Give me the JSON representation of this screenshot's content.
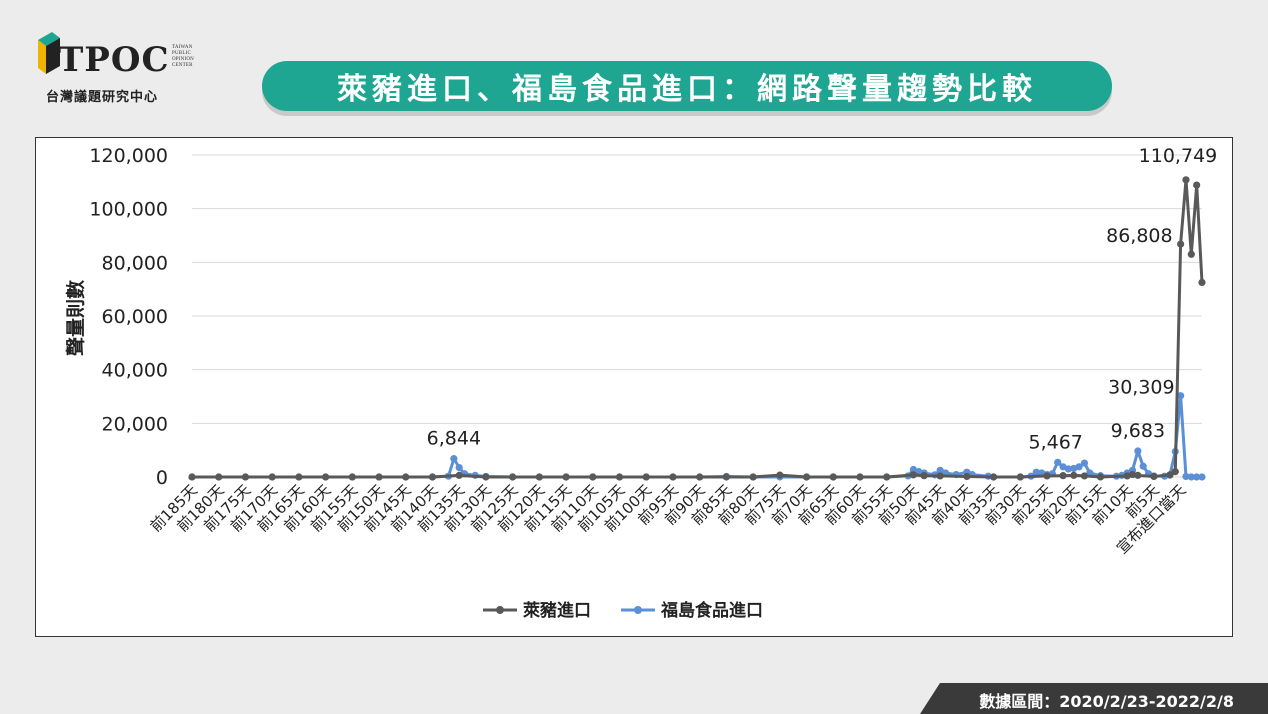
{
  "logo": {
    "name": "TPOC",
    "side_text": [
      "TAIWAN",
      "PUBLIC",
      "OPINION",
      "CENTER"
    ],
    "subtitle": "台灣議題研究中心"
  },
  "title": "萊豬進口、福島食品進口：網路聲量趨勢比較",
  "footer": "數據區間：2020/2/23-2022/2/8",
  "chart_data": {
    "type": "line",
    "ylabel": "聲量則數",
    "ylim": [
      0,
      120000
    ],
    "y_ticks": [
      "120,000",
      "100,000",
      "80,000",
      "60,000",
      "40,000",
      "20,000",
      "0"
    ],
    "x_tick_labels": [
      "前185天",
      "前180天",
      "前175天",
      "前170天",
      "前165天",
      "前160天",
      "前155天",
      "前150天",
      "前145天",
      "前140天",
      "前135天",
      "前130天",
      "前125天",
      "前120天",
      "前115天",
      "前110天",
      "前105天",
      "前100天",
      "前95天",
      "前90天",
      "前85天",
      "前80天",
      "前75天",
      "前70天",
      "前65天",
      "前60天",
      "前55天",
      "前50天",
      "前45天",
      "前40天",
      "前35天",
      "前30天",
      "前25天",
      "前20天",
      "前15天",
      "前10天",
      "前5天",
      "宣布進口當天"
    ],
    "grid": true,
    "legend_position": "bottom",
    "series": [
      {
        "name": "萊豬進口",
        "color": "#595959",
        "points": [
          [
            -185,
            0
          ],
          [
            -180,
            0
          ],
          [
            -175,
            0
          ],
          [
            -170,
            0
          ],
          [
            -165,
            0
          ],
          [
            -160,
            0
          ],
          [
            -155,
            0
          ],
          [
            -150,
            0
          ],
          [
            -145,
            0
          ],
          [
            -140,
            0
          ],
          [
            -135,
            600
          ],
          [
            -130,
            0
          ],
          [
            -125,
            0
          ],
          [
            -120,
            0
          ],
          [
            -115,
            0
          ],
          [
            -110,
            0
          ],
          [
            -105,
            0
          ],
          [
            -100,
            0
          ],
          [
            -95,
            0
          ],
          [
            -90,
            0
          ],
          [
            -85,
            0
          ],
          [
            -80,
            0
          ],
          [
            -75,
            700
          ],
          [
            -70,
            0
          ],
          [
            -65,
            0
          ],
          [
            -60,
            0
          ],
          [
            -55,
            0
          ],
          [
            -50,
            800
          ],
          [
            -48,
            500
          ],
          [
            -45,
            400
          ],
          [
            -40,
            200
          ],
          [
            -35,
            0
          ],
          [
            -30,
            0
          ],
          [
            -25,
            400
          ],
          [
            -22,
            500
          ],
          [
            -20,
            600
          ],
          [
            -18,
            400
          ],
          [
            -15,
            0
          ],
          [
            -10,
            400
          ],
          [
            -9,
            900
          ],
          [
            -8,
            600
          ],
          [
            -5,
            200
          ],
          [
            -2,
            800
          ],
          [
            -1,
            2000
          ],
          [
            0,
            86808
          ],
          [
            1,
            110749
          ],
          [
            2,
            83000
          ],
          [
            3,
            108800
          ],
          [
            4,
            72500
          ]
        ]
      },
      {
        "name": "福島食品進口",
        "color": "#5b8fd6",
        "points": [
          [
            -185,
            0
          ],
          [
            -180,
            0
          ],
          [
            -175,
            0
          ],
          [
            -170,
            0
          ],
          [
            -165,
            0
          ],
          [
            -160,
            0
          ],
          [
            -155,
            0
          ],
          [
            -150,
            0
          ],
          [
            -145,
            0
          ],
          [
            -140,
            0
          ],
          [
            -137,
            300
          ],
          [
            -136,
            6844
          ],
          [
            -135,
            3500
          ],
          [
            -134,
            1200
          ],
          [
            -132,
            600
          ],
          [
            -130,
            200
          ],
          [
            -125,
            0
          ],
          [
            -120,
            0
          ],
          [
            -115,
            0
          ],
          [
            -110,
            0
          ],
          [
            -105,
            0
          ],
          [
            -100,
            0
          ],
          [
            -95,
            0
          ],
          [
            -90,
            0
          ],
          [
            -85,
            200
          ],
          [
            -80,
            0
          ],
          [
            -75,
            0
          ],
          [
            -70,
            0
          ],
          [
            -65,
            0
          ],
          [
            -60,
            0
          ],
          [
            -55,
            0
          ],
          [
            -51,
            400
          ],
          [
            -50,
            2800
          ],
          [
            -49,
            2000
          ],
          [
            -48,
            1500
          ],
          [
            -46,
            800
          ],
          [
            -45,
            2500
          ],
          [
            -44,
            1500
          ],
          [
            -42,
            900
          ],
          [
            -40,
            1800
          ],
          [
            -39,
            900
          ],
          [
            -36,
            300
          ],
          [
            -35,
            0
          ],
          [
            -30,
            0
          ],
          [
            -28,
            300
          ],
          [
            -27,
            1800
          ],
          [
            -26,
            1500
          ],
          [
            -25,
            900
          ],
          [
            -24,
            1200
          ],
          [
            -23,
            5467
          ],
          [
            -22,
            3800
          ],
          [
            -21,
            3000
          ],
          [
            -20,
            3200
          ],
          [
            -19,
            3800
          ],
          [
            -18,
            5200
          ],
          [
            -17,
            1500
          ],
          [
            -15,
            500
          ],
          [
            -12,
            300
          ],
          [
            -11,
            600
          ],
          [
            -10,
            1500
          ],
          [
            -9,
            2500
          ],
          [
            -8,
            9683
          ],
          [
            -7,
            4000
          ],
          [
            -6,
            1200
          ],
          [
            -5,
            400
          ],
          [
            -3,
            300
          ],
          [
            -2,
            700
          ],
          [
            -1,
            9500
          ],
          [
            0,
            30309
          ],
          [
            1,
            200
          ],
          [
            2,
            0
          ],
          [
            3,
            0
          ],
          [
            4,
            0
          ]
        ]
      }
    ],
    "data_labels": [
      {
        "text": "6,844",
        "x": -136,
        "y": 6844
      },
      {
        "text": "5,467",
        "x": -23,
        "y": 5467
      },
      {
        "text": "9,683",
        "x": -8,
        "y": 9683
      },
      {
        "text": "30,309",
        "x": 0,
        "y": 30309
      },
      {
        "text": "86,808",
        "x": 0,
        "y": 86808
      },
      {
        "text": "110,749",
        "x": 1,
        "y": 110749
      }
    ]
  }
}
